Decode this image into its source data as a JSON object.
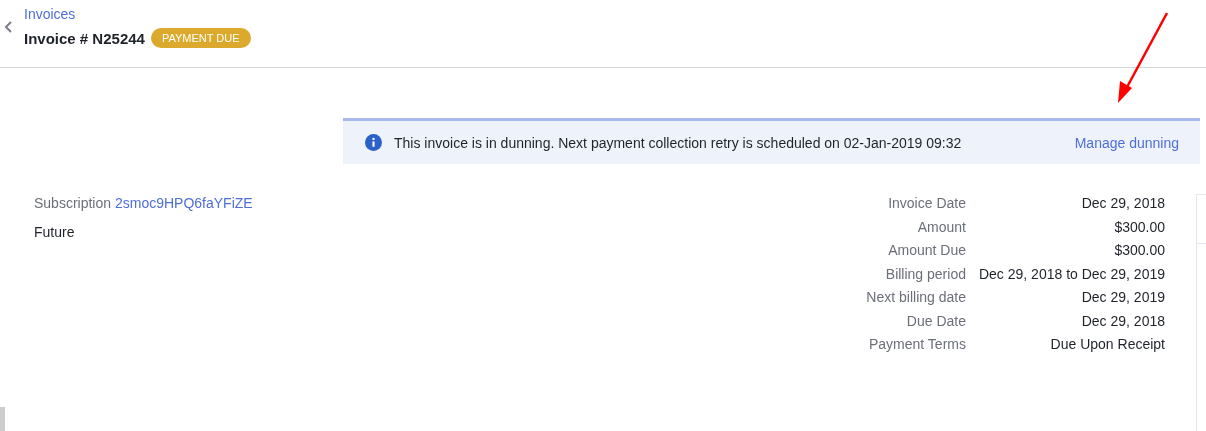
{
  "header": {
    "breadcrumb": "Invoices",
    "title": "Invoice # N25244",
    "status_badge": "PAYMENT DUE"
  },
  "banner": {
    "message": "This invoice is in dunning. Next payment collection retry is scheduled on 02-Jan-2019 09:32",
    "action": "Manage dunning"
  },
  "subscription": {
    "label": "Subscription",
    "id": "2smoc9HPQ6faYFiZE",
    "status": "Future"
  },
  "details": [
    {
      "label": "Invoice Date",
      "value": "Dec 29, 2018"
    },
    {
      "label": "Amount",
      "value": "$300.00"
    },
    {
      "label": "Amount Due",
      "value": "$300.00"
    },
    {
      "label": "Billing period",
      "value": "Dec 29, 2018 to Dec 29, 2019"
    },
    {
      "label": "Next billing date",
      "value": "Dec 29, 2019"
    },
    {
      "label": "Due Date",
      "value": "Dec 29, 2018"
    },
    {
      "label": "Payment Terms",
      "value": "Due Upon Receipt"
    }
  ]
}
